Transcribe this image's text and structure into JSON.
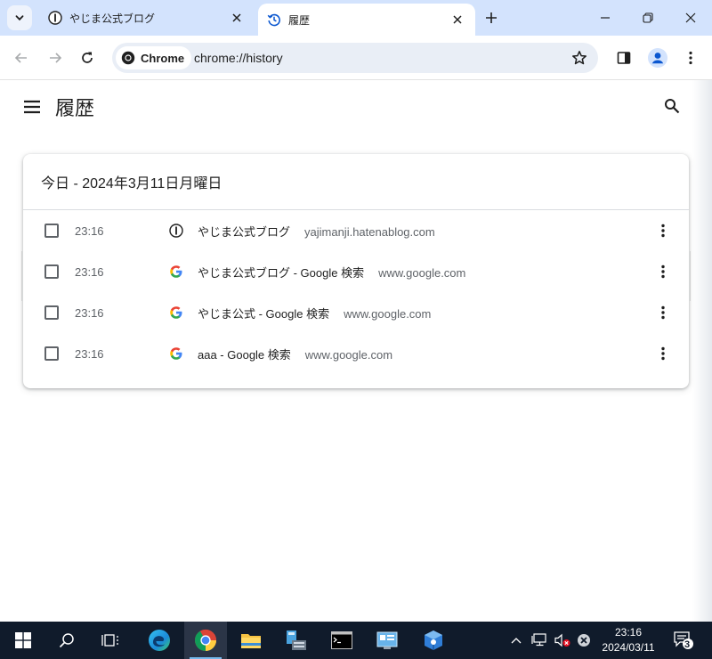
{
  "tabs": [
    {
      "title": "やじま公式ブログ",
      "active": false
    },
    {
      "title": "履歴",
      "active": true
    }
  ],
  "toolbar": {
    "chip_label": "Chrome",
    "url": "chrome://history"
  },
  "history": {
    "page_title": "履歴",
    "day_header": "今日 - 2024年3月11日月曜日",
    "entries": [
      {
        "time": "23:16",
        "favicon": "hatena-icon",
        "title": "やじま公式ブログ",
        "domain": "yajimanji.hatenablog.com"
      },
      {
        "time": "23:16",
        "favicon": "google-icon",
        "title": "やじま公式ブログ - Google 検索",
        "domain": "www.google.com"
      },
      {
        "time": "23:16",
        "favicon": "google-icon",
        "title": "やじま公式 - Google 検索",
        "domain": "www.google.com"
      },
      {
        "time": "23:16",
        "favicon": "google-icon",
        "title": "aaa - Google 検索",
        "domain": "www.google.com"
      }
    ]
  },
  "taskbar": {
    "time": "23:16",
    "date": "2024/03/11",
    "notification_count": "3"
  },
  "colors": {
    "tabstrip": "#d3e3fd",
    "omnibox": "#e9eef6",
    "taskbar": "#101b2b",
    "accent": "#0b57d0"
  }
}
